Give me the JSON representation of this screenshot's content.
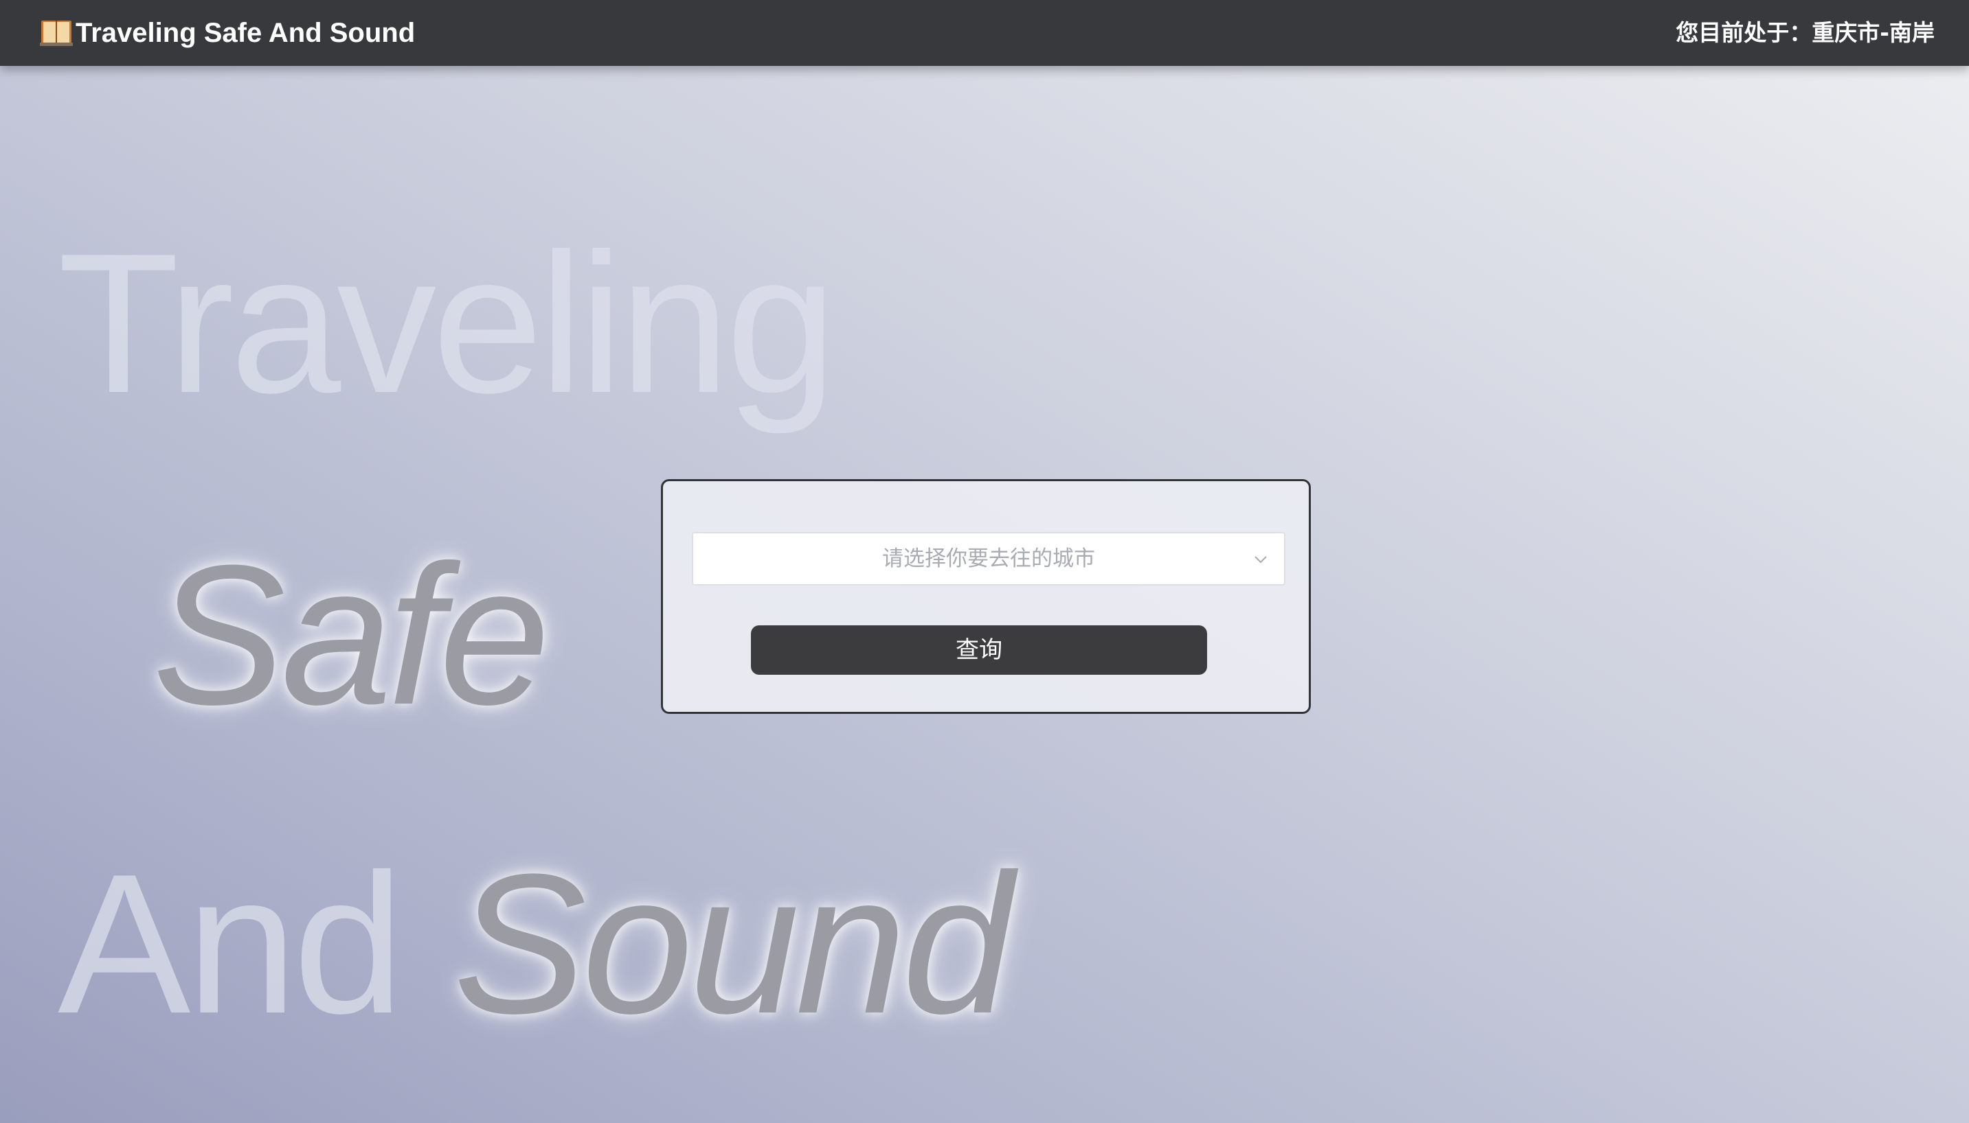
{
  "header": {
    "title": "Traveling Safe And Sound",
    "logo_icon": "open-book-icon",
    "location_text": "您目前处于：重庆市-南岸"
  },
  "hero": {
    "line1": "Traveling",
    "line2": "Safe",
    "line3_word1": "And",
    "line3_word2": "Sound"
  },
  "search": {
    "city_select_placeholder": "请选择你要去往的城市",
    "dropdown_icon": "chevron-down-icon",
    "query_button_label": "查询"
  },
  "colors": {
    "topbar": "#38393d",
    "button": "#3c3c3f",
    "placeholder": "#a8abb2"
  }
}
